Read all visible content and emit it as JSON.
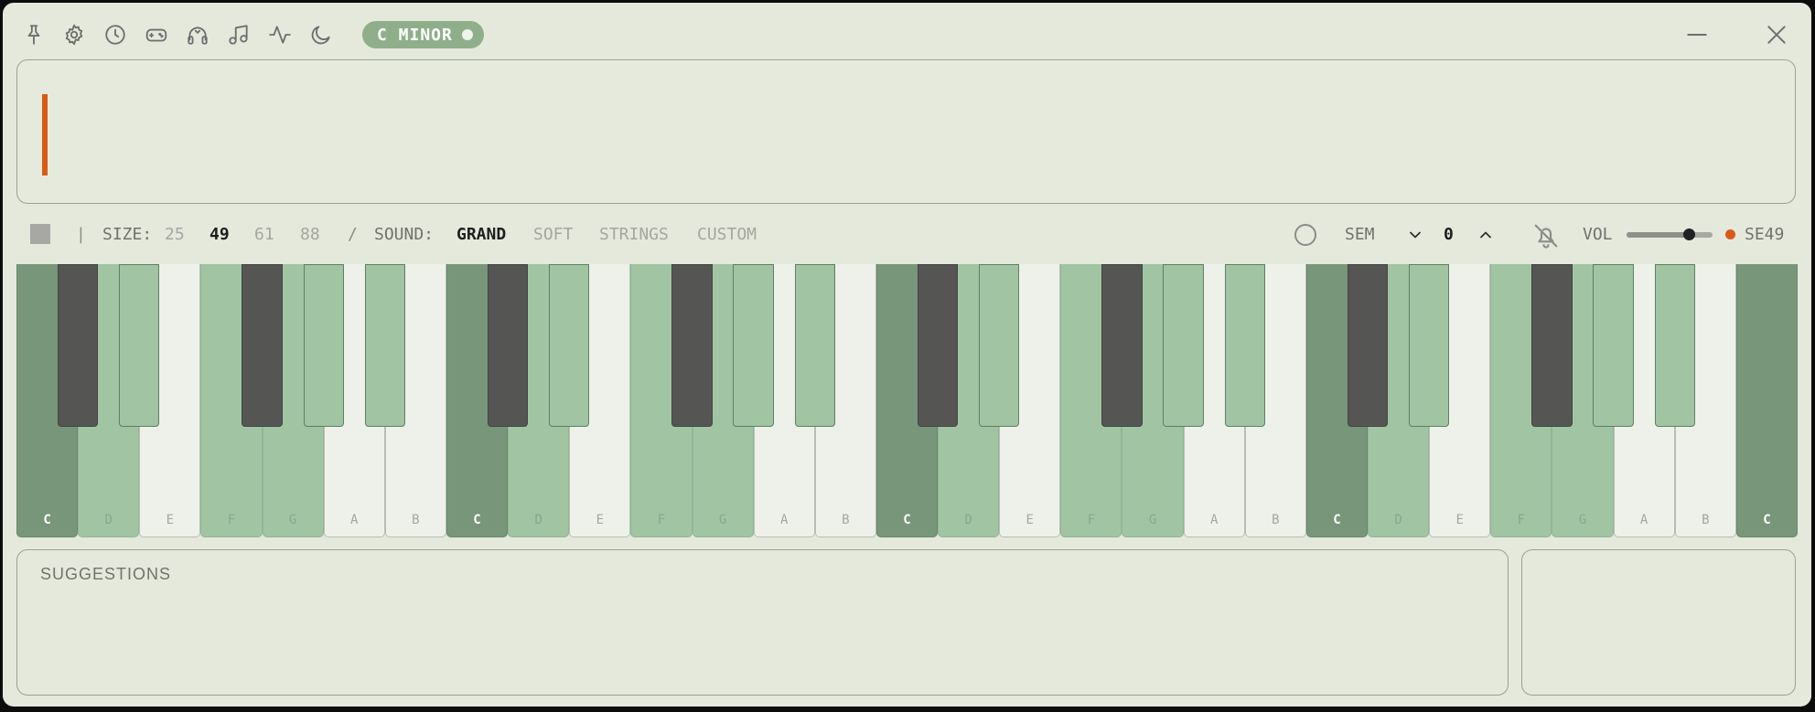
{
  "titlebar": {
    "icons": [
      "pin-icon",
      "gear-icon",
      "clock-icon",
      "gamepad-icon",
      "headphones-icon",
      "music-note-icon",
      "activity-icon",
      "moon-icon"
    ],
    "key_label": "C MINOR"
  },
  "controls": {
    "size_label": "SIZE:",
    "sizes": [
      "25",
      "49",
      "61",
      "88"
    ],
    "active_size": "49",
    "slash": "/",
    "sound_label": "SOUND:",
    "sounds": [
      "GRAND",
      "SOFT",
      "STRINGS",
      "CUSTOM"
    ],
    "active_sound": "GRAND",
    "divider": "|",
    "sem_label": "SEM",
    "semitone_value": "0",
    "vol_label": "VOL",
    "volume_percent": 72,
    "device_label": "SE49"
  },
  "keyboard": {
    "white_keys": [
      "C",
      "D",
      "E",
      "F",
      "G",
      "A",
      "B",
      "C",
      "D",
      "E",
      "F",
      "G",
      "A",
      "B",
      "C",
      "D",
      "E",
      "F",
      "G",
      "A",
      "B",
      "C",
      "D",
      "E",
      "F",
      "G",
      "A",
      "B",
      "C"
    ],
    "scale_notes": [
      "C",
      "D",
      "D#",
      "F",
      "G",
      "G#",
      "A#"
    ],
    "tonic": "C"
  },
  "suggestions": {
    "title": "SUGGESTIONS"
  },
  "colors": {
    "background": "#e4e9dc",
    "tonic_key": "#78967a",
    "scale_key": "#a1c4a3",
    "black_key": "#555553",
    "accent": "#d95a1a",
    "badge": "#8faf8a"
  }
}
